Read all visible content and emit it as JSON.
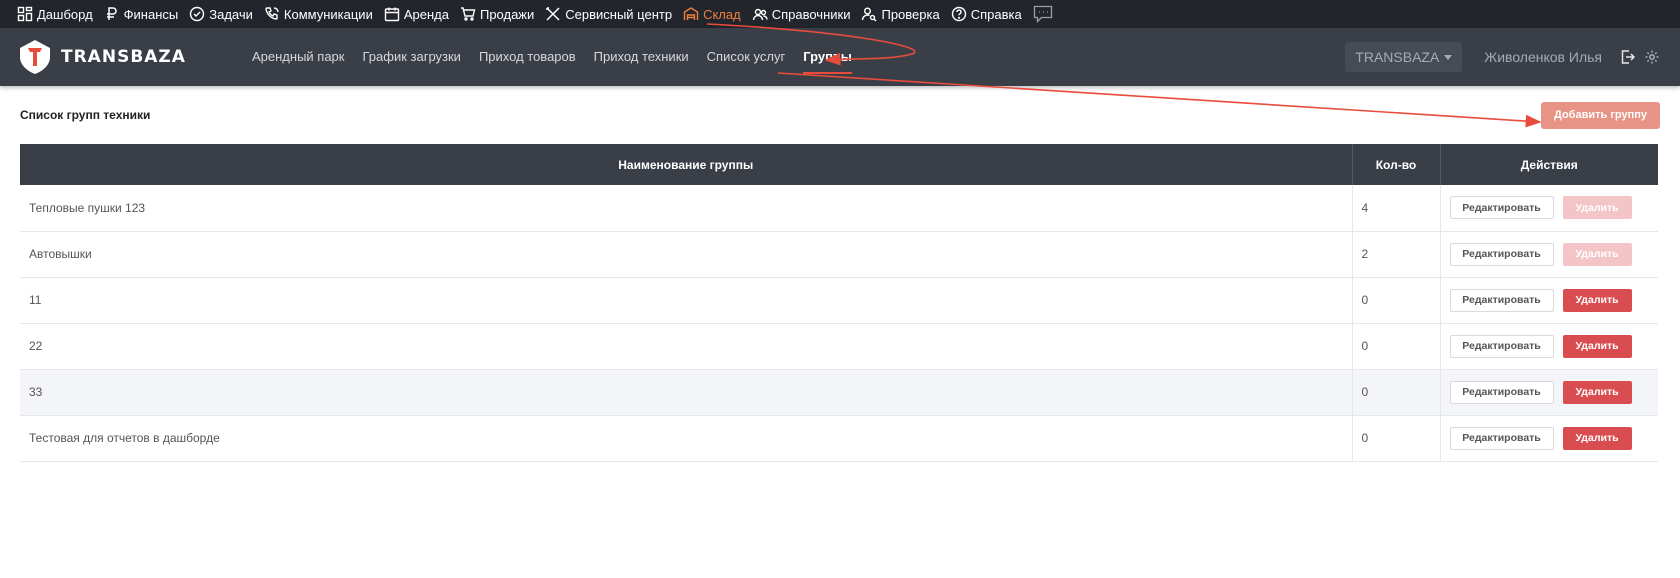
{
  "topnav": {
    "items": [
      {
        "label": "Дашборд",
        "icon": "dashboard-icon"
      },
      {
        "label": "Финансы",
        "icon": "ruble-icon"
      },
      {
        "label": "Задачи",
        "icon": "check-circle-icon"
      },
      {
        "label": "Коммуникации",
        "icon": "phone-icon"
      },
      {
        "label": "Аренда",
        "icon": "calendar-icon"
      },
      {
        "label": "Продажи",
        "icon": "cart-icon"
      },
      {
        "label": "Сервисный центр",
        "icon": "tools-icon"
      },
      {
        "label": "Склад",
        "icon": "warehouse-icon",
        "active": true
      },
      {
        "label": "Справочники",
        "icon": "users-icon"
      },
      {
        "label": "Проверка",
        "icon": "user-search-icon"
      },
      {
        "label": "Справка",
        "icon": "help-icon"
      }
    ],
    "chat_icon": "chat-icon",
    "active_color": "#f07f3c"
  },
  "header": {
    "logo_text": "TRANSBAZA",
    "subnav": [
      {
        "label": "Арендный парк"
      },
      {
        "label": "График загрузки"
      },
      {
        "label": "Приход товаров"
      },
      {
        "label": "Приход техники"
      },
      {
        "label": "Список услуг"
      },
      {
        "label": "Группы",
        "active": true
      }
    ],
    "company": "TRANSBAZA",
    "user_name": "Живоленков Илья"
  },
  "page": {
    "title": "Список групп техники",
    "add_button": "Добавить группу"
  },
  "table": {
    "headers": [
      "Наименование группы",
      "Кол-во",
      "Действия"
    ],
    "edit_label": "Редактировать",
    "delete_label": "Удалить",
    "rows": [
      {
        "name": "Тепловые пушки 123",
        "count": "4",
        "delete_disabled": true
      },
      {
        "name": "Автовышки",
        "count": "2",
        "delete_disabled": true
      },
      {
        "name": "11",
        "count": "0",
        "delete_disabled": false
      },
      {
        "name": "22",
        "count": "0",
        "delete_disabled": false
      },
      {
        "name": "33",
        "count": "0",
        "delete_disabled": false,
        "highlighted": true
      },
      {
        "name": "Тестовая для отчетов в дашборде",
        "count": "0",
        "delete_disabled": false
      }
    ]
  },
  "colors": {
    "topbar": "#22252b",
    "header": "#3a3f47",
    "accent_red": "#d94c4f",
    "annotation": "#e84c3d"
  }
}
